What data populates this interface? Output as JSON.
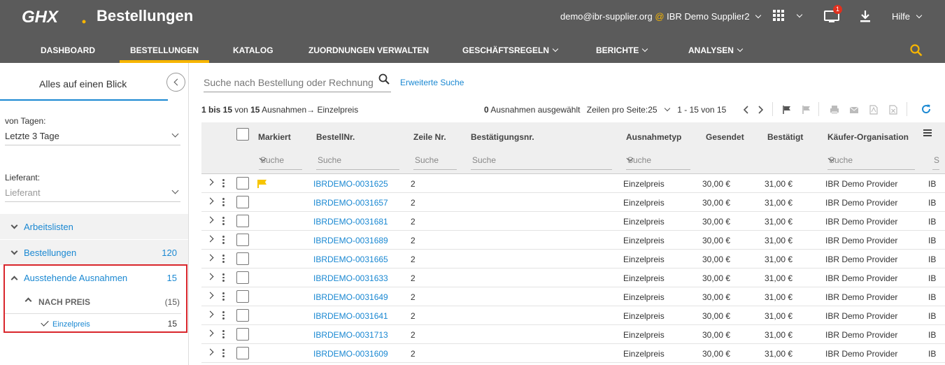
{
  "header": {
    "logo_text": "GHX",
    "app_title": "Bestellungen",
    "user_email": "demo@ibr-supplier.org",
    "user_at": "@",
    "user_org": "IBR Demo Supplier2",
    "notification_count": "1",
    "help_label": "Hilfe",
    "accent_color": "#f7b500",
    "bar_color": "#5b5b5b"
  },
  "nav": {
    "items": [
      {
        "label": "DASHBOARD",
        "active": false,
        "dropdown": false
      },
      {
        "label": "BESTELLUNGEN",
        "active": true,
        "dropdown": false
      },
      {
        "label": "KATALOG",
        "active": false,
        "dropdown": false
      },
      {
        "label": "ZUORDNUNGEN VERWALTEN",
        "active": false,
        "dropdown": false
      },
      {
        "label": "GESCHÄFTSREGELN",
        "active": false,
        "dropdown": true
      },
      {
        "label": "BERICHTE",
        "active": false,
        "dropdown": true
      },
      {
        "label": "ANALYSEN",
        "active": false,
        "dropdown": true
      }
    ]
  },
  "sidebar": {
    "tab_label": "Alles auf einen Blick",
    "days_label": "von Tagen:",
    "days_value": "Letzte 3 Tage",
    "supplier_label": "Lieferant:",
    "supplier_placeholder": "Lieferant",
    "worklists_label": "Arbeitslisten",
    "orders_label": "Bestellungen",
    "orders_count": "120",
    "pending_label": "Ausstehende Ausnahmen",
    "pending_count": "15",
    "by_price_label": "NACH PREIS",
    "by_price_count": "(15)",
    "unit_price_label": "Einzelpreis",
    "unit_price_count": "15"
  },
  "main": {
    "search_placeholder": "Suche nach Bestellung oder Rechnung",
    "advanced_search": "Erweiterte Suche",
    "summary_range": "1 bis 15",
    "summary_of": "von",
    "summary_total": "15",
    "summary_label": "Ausnahmen",
    "summary_arrow": "→",
    "summary_filter": "Einzelpreis",
    "selected_count": "0",
    "selected_label": "Ausnahmen ausgewählt",
    "rows_per_page_label": "Zeilen pro Seite:",
    "rows_per_page_value": "25",
    "page_range": "1 - 15 von 15"
  },
  "table": {
    "columns": {
      "flagged": "Markiert",
      "order_no": "BestellNr.",
      "line_no": "Zeile Nr.",
      "confirm_no": "Bestätigungsnr.",
      "exception_type": "Ausnahmetyp",
      "sent": "Gesendet",
      "confirmed": "Bestätigt",
      "buyer_org": "Käufer-Organisation"
    },
    "filter_placeholder": "Suche",
    "rows": [
      {
        "order": "IBRDEMO-0031625",
        "line": "2",
        "type": "Einzelpreis",
        "sent": "30,00 €",
        "confirmed": "31,00 €",
        "buyer": "IBR Demo Provider",
        "extra": "IB",
        "flagged": true
      },
      {
        "order": "IBRDEMO-0031657",
        "line": "2",
        "type": "Einzelpreis",
        "sent": "30,00 €",
        "confirmed": "31,00 €",
        "buyer": "IBR Demo Provider",
        "extra": "IB",
        "flagged": false
      },
      {
        "order": "IBRDEMO-0031681",
        "line": "2",
        "type": "Einzelpreis",
        "sent": "30,00 €",
        "confirmed": "31,00 €",
        "buyer": "IBR Demo Provider",
        "extra": "IB",
        "flagged": false
      },
      {
        "order": "IBRDEMO-0031689",
        "line": "2",
        "type": "Einzelpreis",
        "sent": "30,00 €",
        "confirmed": "31,00 €",
        "buyer": "IBR Demo Provider",
        "extra": "IB",
        "flagged": false
      },
      {
        "order": "IBRDEMO-0031665",
        "line": "2",
        "type": "Einzelpreis",
        "sent": "30,00 €",
        "confirmed": "31,00 €",
        "buyer": "IBR Demo Provider",
        "extra": "IB",
        "flagged": false
      },
      {
        "order": "IBRDEMO-0031633",
        "line": "2",
        "type": "Einzelpreis",
        "sent": "30,00 €",
        "confirmed": "31,00 €",
        "buyer": "IBR Demo Provider",
        "extra": "IB",
        "flagged": false
      },
      {
        "order": "IBRDEMO-0031649",
        "line": "2",
        "type": "Einzelpreis",
        "sent": "30,00 €",
        "confirmed": "31,00 €",
        "buyer": "IBR Demo Provider",
        "extra": "IB",
        "flagged": false
      },
      {
        "order": "IBRDEMO-0031641",
        "line": "2",
        "type": "Einzelpreis",
        "sent": "30,00 €",
        "confirmed": "31,00 €",
        "buyer": "IBR Demo Provider",
        "extra": "IB",
        "flagged": false
      },
      {
        "order": "IBRDEMO-0031713",
        "line": "2",
        "type": "Einzelpreis",
        "sent": "30,00 €",
        "confirmed": "31,00 €",
        "buyer": "IBR Demo Provider",
        "extra": "IB",
        "flagged": false
      },
      {
        "order": "IBRDEMO-0031609",
        "line": "2",
        "type": "Einzelpreis",
        "sent": "30,00 €",
        "confirmed": "31,00 €",
        "buyer": "IBR Demo Provider",
        "extra": "IB",
        "flagged": false
      }
    ]
  }
}
